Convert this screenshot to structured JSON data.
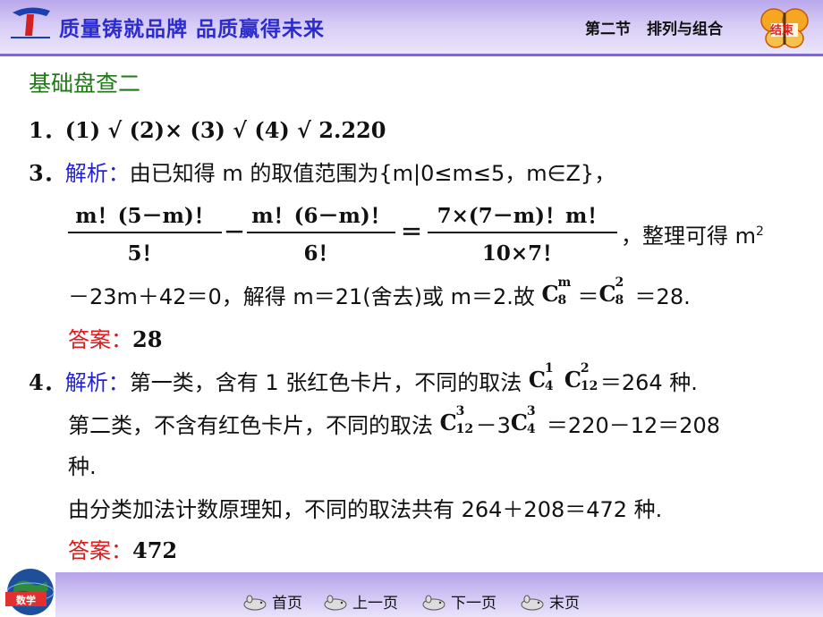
{
  "header": {
    "slogan": "质量铸就品牌  品质赢得未来",
    "section_number": "第二节",
    "section_title": "排列与组合",
    "end_button": "结束"
  },
  "content": {
    "title": "基础盘查二",
    "q1": {
      "num": "1．",
      "text": "(1) √    (2)×    (3) √    (4) √    2.220"
    },
    "q3": {
      "num": "3．",
      "label": "解析：",
      "line1": "由已知得  m  的取值范围为{m|0≤m≤5，m∈Z}，",
      "frac1_num": "m！(5－m)！",
      "frac1_den": "5！",
      "minus": "－",
      "frac2_num": "m！(6－m)！",
      "frac2_den": "6！",
      "eq": "＝",
      "frac3_num": "7×(7－m)！m！",
      "frac3_den": "10×7！",
      "tail": "，整理可得  m",
      "tail_sup": "2",
      "line3_a": "－23m＋42＝0，解得 m＝21(舍去)或 m＝2.故 ",
      "line3_b": "＝",
      "line3_c": "＝28.",
      "answer_label": "答案：",
      "answer": "28"
    },
    "q4": {
      "num": "4．",
      "label": "解析：",
      "line1_a": "第一类，含有 1 张红色卡片，不同的取法 ",
      "line1_b": "＝264 种.",
      "line2_a": "第二类，不含有红色卡片，不同的取法 ",
      "line2_b": "－3",
      "line2_c": "＝220－12＝208",
      "line3": "种.",
      "line4": "由分类加法计数原理知，不同的取法共有 264＋208＝472 种.",
      "answer_label": "答案：",
      "answer": "472"
    },
    "comb": {
      "C": "C",
      "c8m_up": "m",
      "c8m_dn": "8",
      "c82_up": "2",
      "c82_dn": "8",
      "c41_up": "1",
      "c41_dn": "4",
      "c122_up": "2",
      "c122_dn": "12",
      "c123_up": "3",
      "c123_dn": "12",
      "c43_up": "3",
      "c43_dn": "4"
    }
  },
  "footer": {
    "logo_text": "数学",
    "nav": [
      "首页",
      "上一页",
      "下一页",
      "末页"
    ]
  },
  "colors": {
    "accent": "#2222dd",
    "answer": "#e01a1a",
    "title": "#1f7a16",
    "band": "#b9a7ec"
  }
}
